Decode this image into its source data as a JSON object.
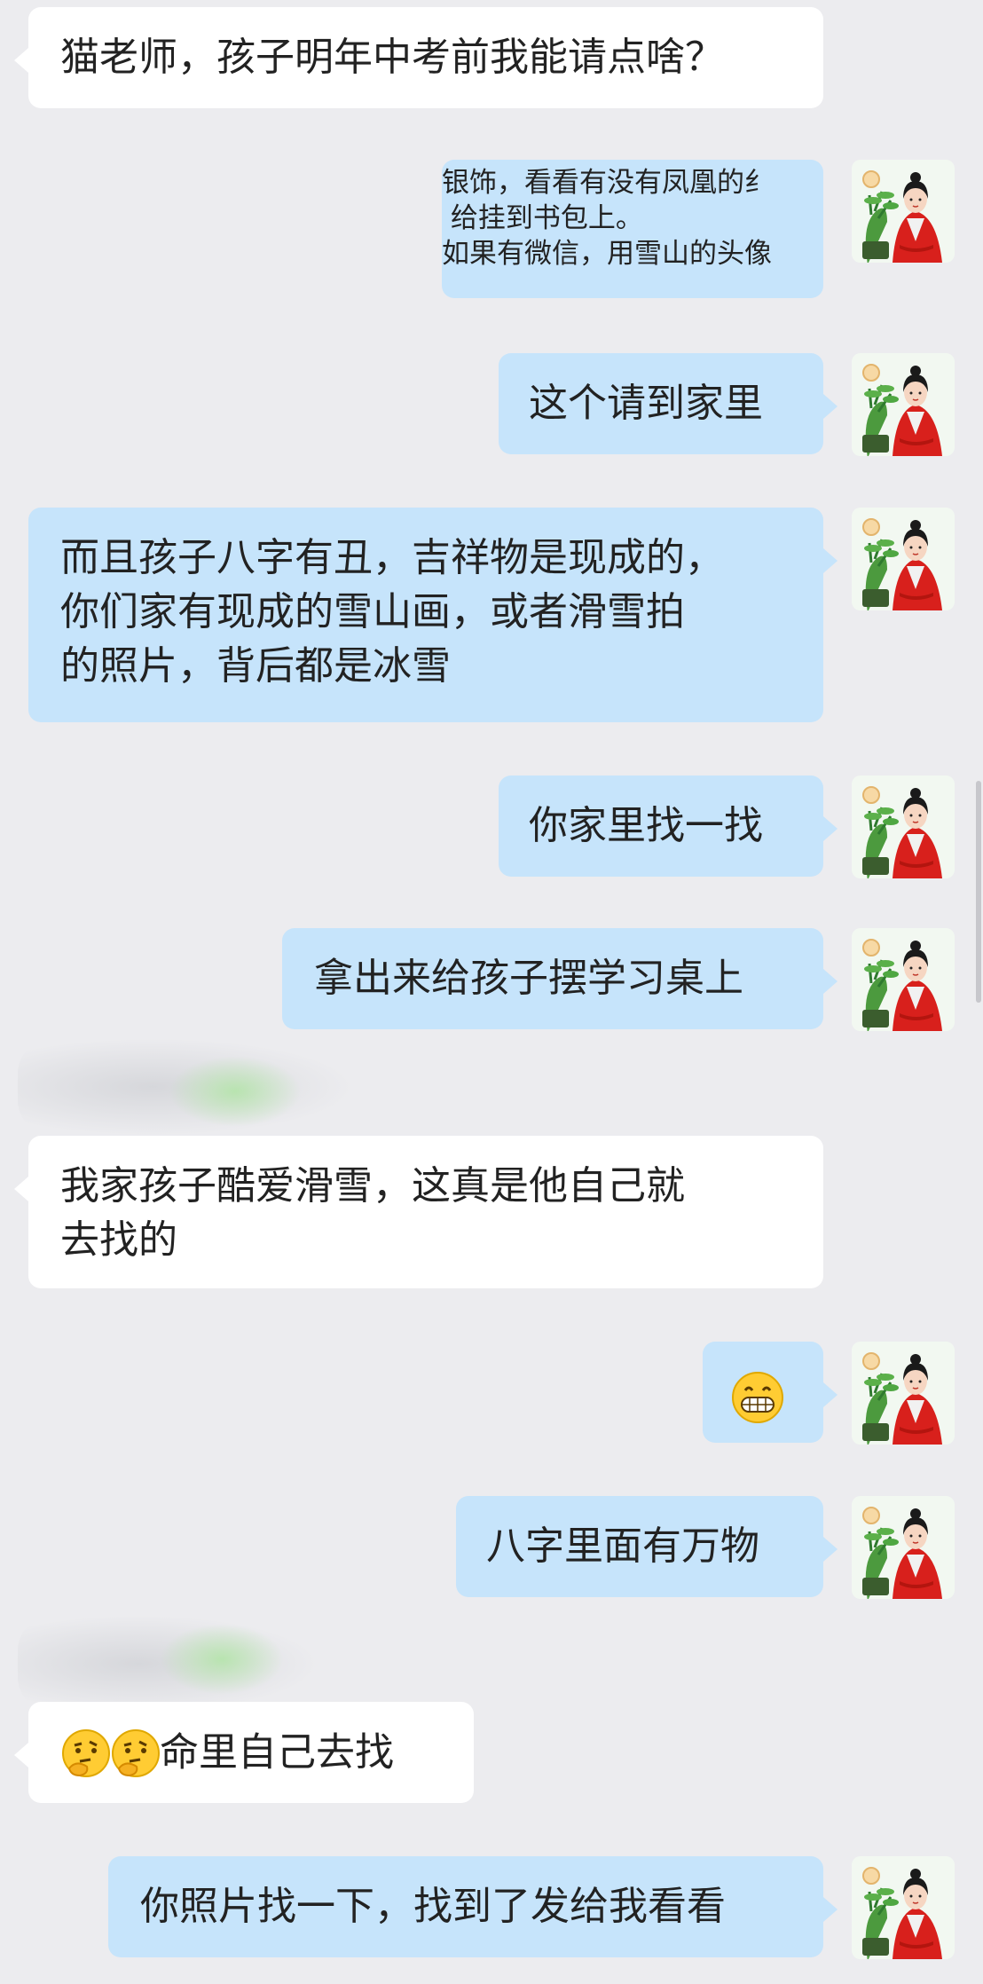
{
  "messages": [
    {
      "id": "m1",
      "side": "in",
      "text": "猫老师，孩子明年中考前我能请点啥？"
    },
    {
      "id": "m2",
      "side": "out",
      "lines": [
        "银饰，看看有没有凤凰的纟",
        " 给挂到书包上。",
        "如果有微信，用雪山的头像"
      ]
    },
    {
      "id": "m3",
      "side": "out",
      "text": "这个请到家里"
    },
    {
      "id": "m4",
      "side": "out",
      "lines": [
        "而且孩子八字有丑，吉祥物是现成的，",
        "你们家有现成的雪山画，或者滑雪拍",
        "的照片，背后都是冰雪"
      ]
    },
    {
      "id": "m5",
      "side": "out",
      "text": "你家里找一找"
    },
    {
      "id": "m6",
      "side": "out",
      "text": "拿出来给孩子摆学习桌上"
    },
    {
      "id": "m7",
      "side": "in",
      "lines": [
        "我家孩子酷爱滑雪，这真是他自己就",
        "去找的"
      ]
    },
    {
      "id": "m8",
      "side": "out",
      "emoji": "grinning-face"
    },
    {
      "id": "m9",
      "side": "out",
      "text": "八字里面有万物"
    },
    {
      "id": "m10",
      "side": "in",
      "emoji": "thinking-face",
      "text": "命里自己去找"
    },
    {
      "id": "m11",
      "side": "out",
      "text": "你照片找一下，找到了发给我看看"
    }
  ],
  "avatar": {
    "icon": "teacher-avatar-red-robe",
    "accent": "#d8201c",
    "plant": "#3a8a3a"
  },
  "colors": {
    "background": "#ececef",
    "incoming": "#ffffff",
    "outgoing": "#c6e4fb",
    "text": "#222222"
  }
}
